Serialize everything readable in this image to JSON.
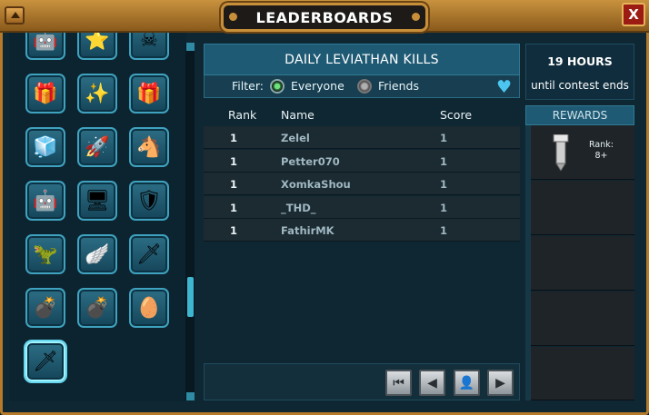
{
  "window": {
    "title": "LEADERBOARDS",
    "close_label": "X"
  },
  "left_items": [
    {
      "icon": "robot-icon",
      "glyph": "🤖"
    },
    {
      "icon": "gold-star-icon",
      "glyph": "⭐"
    },
    {
      "icon": "red-skull-icon",
      "glyph": "☠"
    },
    {
      "icon": "treasure-chest-icon",
      "glyph": "🎁"
    },
    {
      "icon": "gold-sparkle-icon",
      "glyph": "✨"
    },
    {
      "icon": "gold-gift-box-icon",
      "glyph": "🎁"
    },
    {
      "icon": "gold-cube-icon",
      "glyph": "🧊"
    },
    {
      "icon": "rocket-toy-icon",
      "glyph": "🚀"
    },
    {
      "icon": "toy-horse-icon",
      "glyph": "🐴"
    },
    {
      "icon": "robot-suit-icon",
      "glyph": "🤖"
    },
    {
      "icon": "server-rack-icon",
      "glyph": "🖥"
    },
    {
      "icon": "xp-shield-icon",
      "glyph": "🛡"
    },
    {
      "icon": "dinosaur-skull-icon",
      "glyph": "🦖"
    },
    {
      "icon": "xp-wings-badge-icon",
      "glyph": "🪽"
    },
    {
      "icon": "green-sword-icon",
      "glyph": "🗡"
    },
    {
      "icon": "spiked-bomb-icon",
      "glyph": "💣"
    },
    {
      "icon": "red-drop-bomb-icon",
      "glyph": "💣"
    },
    {
      "icon": "golden-egg-icon",
      "glyph": "🥚"
    },
    {
      "icon": "green-crystal-sword-icon",
      "glyph": "🗡"
    }
  ],
  "leaderboard": {
    "title": "DAILY LEVIATHAN KILLS",
    "filter_label": "Filter:",
    "filter_options": [
      "Everyone",
      "Friends"
    ],
    "filter_selected": "Everyone",
    "columns": [
      "Rank",
      "Name",
      "Score"
    ],
    "rows": [
      {
        "rank": "1",
        "name": "Zelel",
        "score": "1"
      },
      {
        "rank": "1",
        "name": "Petter070",
        "score": "1"
      },
      {
        "rank": "1",
        "name": "XomkaShou",
        "score": "1"
      },
      {
        "rank": "1",
        "name": "_THD_",
        "score": "1"
      },
      {
        "rank": "1",
        "name": "FathirMK",
        "score": "1"
      }
    ]
  },
  "pager": [
    {
      "name": "first-page-icon",
      "glyph": "⏮"
    },
    {
      "name": "previous-page-icon",
      "glyph": "◀"
    },
    {
      "name": "my-rank-user-icon",
      "glyph": "👤"
    },
    {
      "name": "next-page-icon",
      "glyph": "▶"
    }
  ],
  "contest": {
    "hours": "19 HOURS",
    "until": "until contest ends"
  },
  "rewards": {
    "header": "REWARDS",
    "items": [
      {
        "icon": "trophy-post-icon",
        "rank_label": "Rank:",
        "rank_value": "8+"
      }
    ]
  },
  "colors": {
    "accent": "#1f5a74",
    "frame": "#b57a2a",
    "close": "#9c1b12",
    "heart": "#4cc6f0"
  }
}
